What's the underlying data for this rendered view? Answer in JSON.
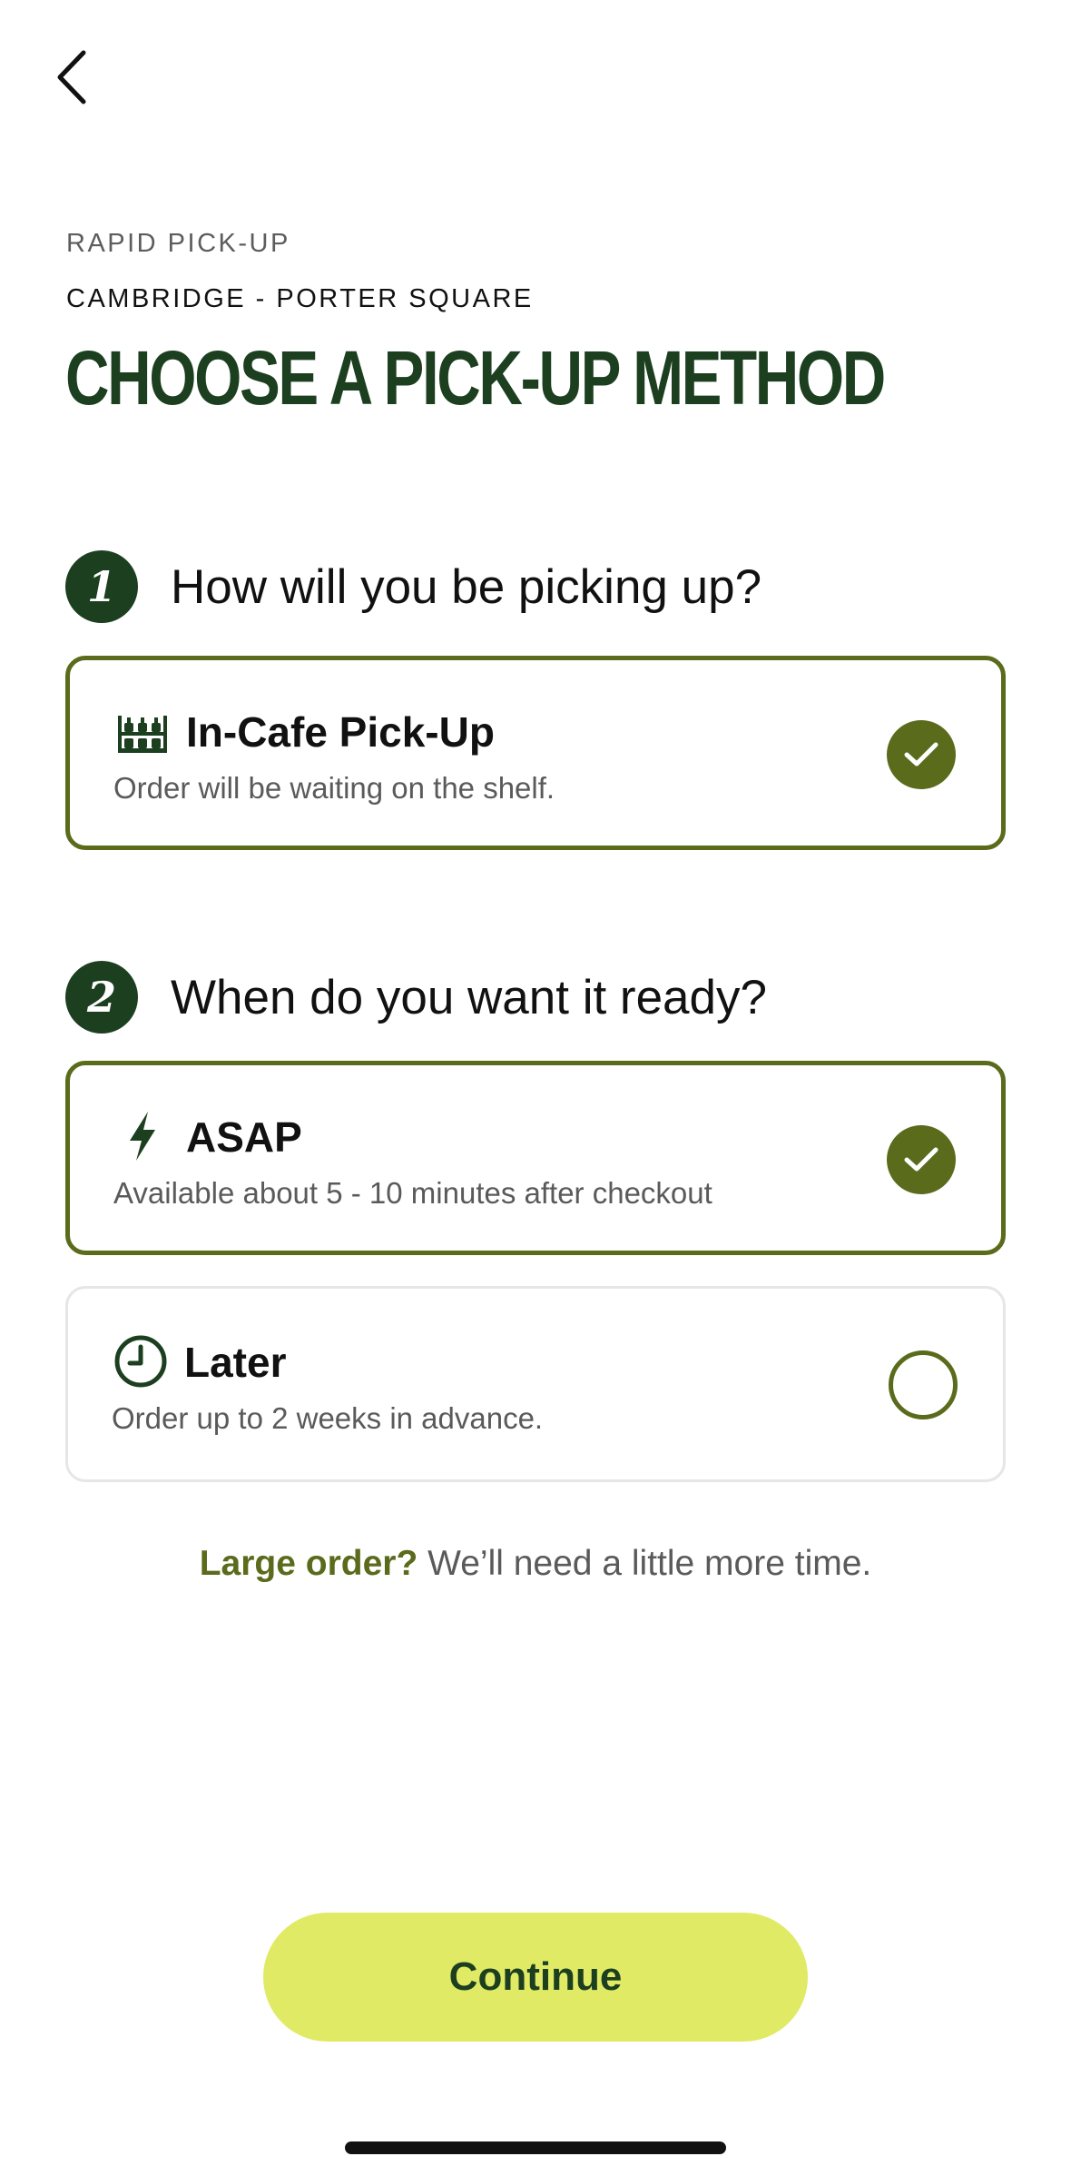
{
  "header": {
    "eyebrow": "RAPID PICK-UP",
    "location": "CAMBRIDGE - PORTER SQUARE",
    "title": "CHOOSE A PICK-UP METHOD"
  },
  "step1": {
    "number": "1",
    "question": "How will you be picking up?",
    "options": [
      {
        "icon": "shelf-icon",
        "title": "In-Cafe Pick-Up",
        "description": "Order will be waiting on the shelf.",
        "selected": true
      }
    ]
  },
  "step2": {
    "number": "2",
    "question": "When do you want it ready?",
    "options": [
      {
        "icon": "lightning-icon",
        "title": "ASAP",
        "description": "Available about 5 - 10 minutes after checkout",
        "selected": true
      },
      {
        "icon": "clock-icon",
        "title": "Later",
        "description": "Order up to 2 weeks in advance.",
        "selected": false
      }
    ]
  },
  "large_order": {
    "link_text": "Large order?",
    "rest_text": " We’ll need a little more time."
  },
  "footer": {
    "continue_label": "Continue"
  },
  "colors": {
    "brand_dark_green": "#1c3f20",
    "selected_olive": "#5a6b1c",
    "button_lime": "#e0ea64"
  }
}
